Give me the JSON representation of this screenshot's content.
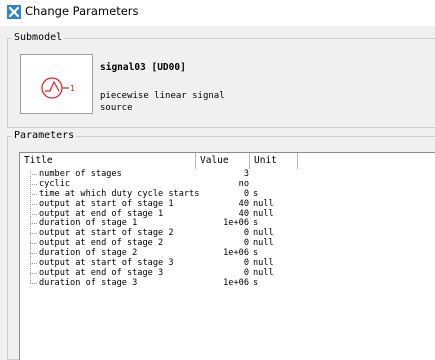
{
  "window": {
    "title": "Change Parameters",
    "icon": "app-x-icon",
    "accent_color": "#2f84d6"
  },
  "submodel": {
    "group_label": "Submodel",
    "name": "signal03 [UD00]",
    "description_line1": "piecewise linear signal",
    "description_line2": "source",
    "symbol_icon": "signal-source-icon",
    "symbol_color": "#e02020",
    "symbol_port_label": "1"
  },
  "parameters": {
    "group_label": "Parameters",
    "columns": [
      "Title",
      "Value",
      "Unit"
    ],
    "rows": [
      {
        "title": "number of stages",
        "value": "3",
        "unit": ""
      },
      {
        "title": "cyclic",
        "value": "no",
        "unit": ""
      },
      {
        "title": "time at which duty cycle starts",
        "value": "0",
        "unit": "s"
      },
      {
        "title": "output at start of stage 1",
        "value": "40",
        "unit": "null"
      },
      {
        "title": "output at end of stage 1",
        "value": "40",
        "unit": "null"
      },
      {
        "title": "duration of stage 1",
        "value": "1e+06",
        "unit": "s"
      },
      {
        "title": "output at start of stage 2",
        "value": "0",
        "unit": "null"
      },
      {
        "title": "output at end of stage 2",
        "value": "0",
        "unit": "null"
      },
      {
        "title": "duration of stage 2",
        "value": "1e+06",
        "unit": "s"
      },
      {
        "title": "output at start of stage 3",
        "value": "0",
        "unit": "null"
      },
      {
        "title": "output at end of stage 3",
        "value": "0",
        "unit": "null"
      },
      {
        "title": "duration of stage 3",
        "value": "1e+06",
        "unit": "s"
      }
    ]
  }
}
